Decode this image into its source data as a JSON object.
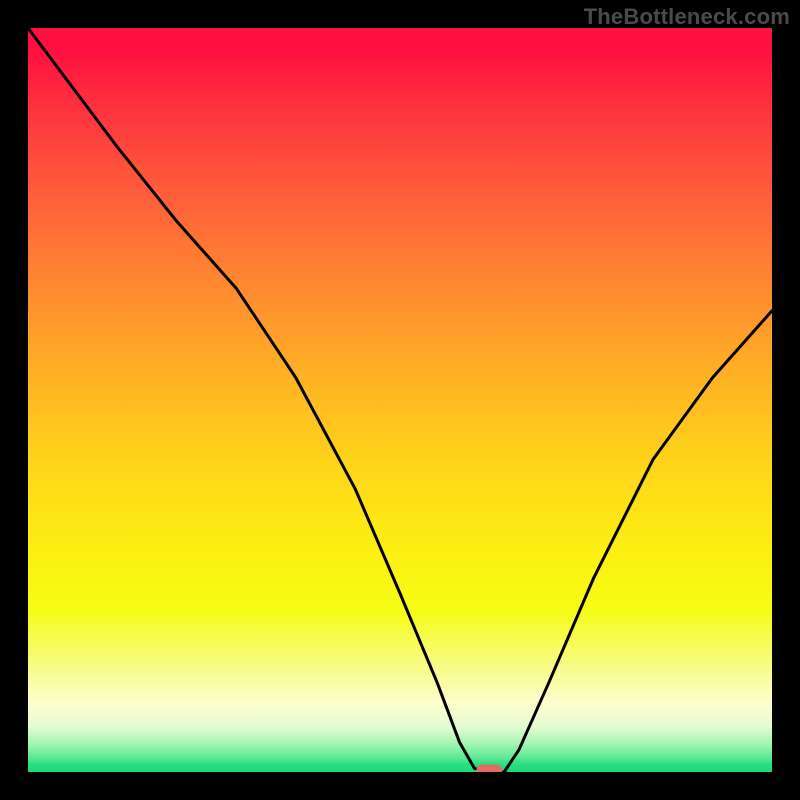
{
  "watermark": "TheBottleneck.com",
  "chart_data": {
    "type": "line",
    "title": "",
    "xlabel": "",
    "ylabel": "",
    "xlim": [
      0,
      100
    ],
    "ylim": [
      0,
      100
    ],
    "grid": false,
    "legend": false,
    "series": [
      {
        "name": "bottleneck-curve",
        "x": [
          0,
          6,
          12,
          20,
          28,
          36,
          44,
          50,
          55,
          58,
          60,
          62,
          64,
          66,
          70,
          76,
          84,
          92,
          100
        ],
        "values": [
          100,
          92,
          84,
          74,
          65,
          53,
          38,
          24,
          12,
          4,
          0.5,
          0,
          0,
          3,
          12,
          26,
          42,
          53,
          62
        ]
      }
    ],
    "minimum_marker": {
      "x": 62,
      "y": 0,
      "color": "#e26b63"
    },
    "background_gradient": {
      "stops": [
        {
          "pos": 0.0,
          "color": "#fe1040"
        },
        {
          "pos": 0.5,
          "color": "#ffc81e"
        },
        {
          "pos": 0.8,
          "color": "#f6fc13"
        },
        {
          "pos": 1.0,
          "color": "#19da7a"
        }
      ]
    }
  }
}
